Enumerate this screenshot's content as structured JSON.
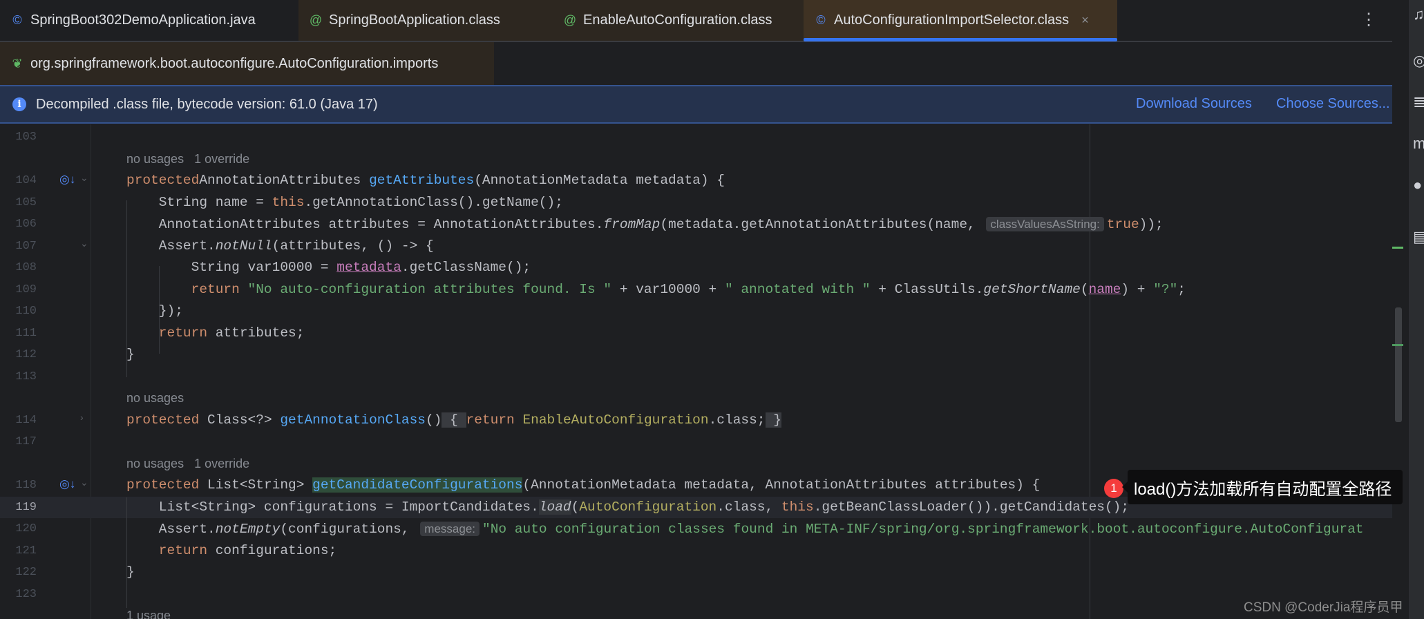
{
  "tabs": [
    {
      "label": "SpringBoot302DemoApplication.java",
      "icon": "class-run-icon"
    },
    {
      "label": "SpringBootApplication.class",
      "icon": "annotation-icon"
    },
    {
      "label": "EnableAutoConfiguration.class",
      "icon": "annotation-icon"
    },
    {
      "label": "AutoConfigurationImportSelector.class",
      "icon": "class-icon",
      "close": "×"
    }
  ],
  "tabs_row2": [
    {
      "label": "org.springframework.boot.autoconfigure.AutoConfiguration.imports",
      "icon": "spring-file-icon"
    }
  ],
  "more_menu": "⋮",
  "banner": {
    "text": "Decompiled .class file, bytecode version: 61.0 (Java 17)",
    "download": "Download Sources",
    "choose": "Choose Sources..."
  },
  "lines": [
    {
      "n": "103",
      "c": []
    },
    {
      "hint": "no usages   1 override"
    },
    {
      "n": "104",
      "gutter": "override",
      "fold": true,
      "c": [
        [
          "kw",
          "protected"
        ],
        [
          "",
          "AnnotationAttributes "
        ],
        [
          "fn",
          "getAttributes"
        ],
        [
          "",
          "(AnnotationMetadata metadata) {"
        ]
      ]
    },
    {
      "n": "105",
      "c": [
        [
          "",
          "    String name = "
        ],
        [
          "kw",
          "this"
        ],
        [
          "",
          ".getAnnotationClass().getName();"
        ]
      ]
    },
    {
      "n": "106",
      "c": [
        [
          "",
          "    AnnotationAttributes attributes = AnnotationAttributes."
        ],
        [
          "it",
          "fromMap"
        ],
        [
          "",
          "(metadata.getAnnotationAttributes(name, "
        ],
        [
          "inl",
          "classValuesAsString:"
        ],
        [
          "kw",
          "true"
        ],
        [
          "",
          "));"
        ]
      ]
    },
    {
      "n": "107",
      "fold": true,
      "c": [
        [
          "",
          "    Assert."
        ],
        [
          "it",
          "notNull"
        ],
        [
          "",
          "(attributes, () -> {"
        ]
      ]
    },
    {
      "n": "108",
      "c": [
        [
          "",
          "        String var10000 = "
        ],
        [
          "pm",
          "metadata"
        ],
        [
          "",
          ".getClassName();"
        ]
      ]
    },
    {
      "n": "109",
      "c": [
        [
          "kw",
          "        return "
        ],
        [
          "st",
          "\"No auto-configuration attributes found. Is \""
        ],
        [
          "",
          " + var10000 + "
        ],
        [
          "st",
          "\" annotated with \""
        ],
        [
          "",
          " + ClassUtils."
        ],
        [
          "it",
          "getShortName"
        ],
        [
          "",
          "("
        ],
        [
          "pm",
          "name"
        ],
        [
          "",
          ") + "
        ],
        [
          "st",
          "\"?\""
        ],
        [
          "",
          ";"
        ]
      ]
    },
    {
      "n": "110",
      "c": [
        [
          "",
          "    });"
        ]
      ]
    },
    {
      "n": "111",
      "c": [
        [
          "kw",
          "    return"
        ],
        [
          "",
          " attributes;"
        ]
      ]
    },
    {
      "n": "112",
      "c": [
        [
          "",
          "}"
        ]
      ]
    },
    {
      "n": "113",
      "c": []
    },
    {
      "hint": "no usages"
    },
    {
      "n": "114",
      "collapsed": true,
      "c": [
        [
          "kw",
          "protected"
        ],
        [
          "",
          " Class<?> "
        ],
        [
          "fn",
          "getAnnotationClass"
        ],
        [
          "",
          "()"
        ],
        [
          "fold",
          " { "
        ],
        [
          "kw",
          "return "
        ],
        [
          "cls",
          "EnableAutoConfiguration"
        ],
        [
          "",
          ".class;"
        ],
        [
          "fold",
          " }"
        ]
      ]
    },
    {
      "n": "117",
      "c": []
    },
    {
      "hint": "no usages   1 override"
    },
    {
      "n": "118",
      "gutter": "override",
      "fold": true,
      "c": [
        [
          "kw",
          "protected"
        ],
        [
          "",
          " List<String> "
        ],
        [
          "hl fn",
          "getCandidateConfigurations"
        ],
        [
          "",
          "(AnnotationMetadata metadata, AnnotationAttributes attributes) {"
        ]
      ]
    },
    {
      "n": "119",
      "current": true,
      "c": [
        [
          "",
          "    List<String> configurations = ImportCandidates."
        ],
        [
          "it ld",
          "load"
        ],
        [
          "",
          "("
        ],
        [
          "cls",
          "AutoConfiguration"
        ],
        [
          "",
          ".class, "
        ],
        [
          "kw",
          "this"
        ],
        [
          "",
          ".getBeanClassLoader()).getCandidates();"
        ]
      ]
    },
    {
      "n": "120",
      "c": [
        [
          "",
          "    Assert."
        ],
        [
          "it",
          "notEmpty"
        ],
        [
          "",
          "(configurations, "
        ],
        [
          "inl",
          "message:"
        ],
        [
          "st",
          "\"No auto configuration classes found in META-INF/spring/org.springframework.boot.autoconfigure.AutoConfigurat"
        ]
      ]
    },
    {
      "n": "121",
      "c": [
        [
          "kw",
          "    return"
        ],
        [
          "",
          " configurations;"
        ]
      ]
    },
    {
      "n": "122",
      "c": [
        [
          "",
          "}"
        ]
      ]
    },
    {
      "n": "123",
      "c": []
    },
    {
      "hint": "1 usage"
    }
  ],
  "annotation": {
    "badge": "1",
    "text": "load()方法加载所有自动配置全路径"
  },
  "watermark": "CSDN @CoderJia程序员甲"
}
